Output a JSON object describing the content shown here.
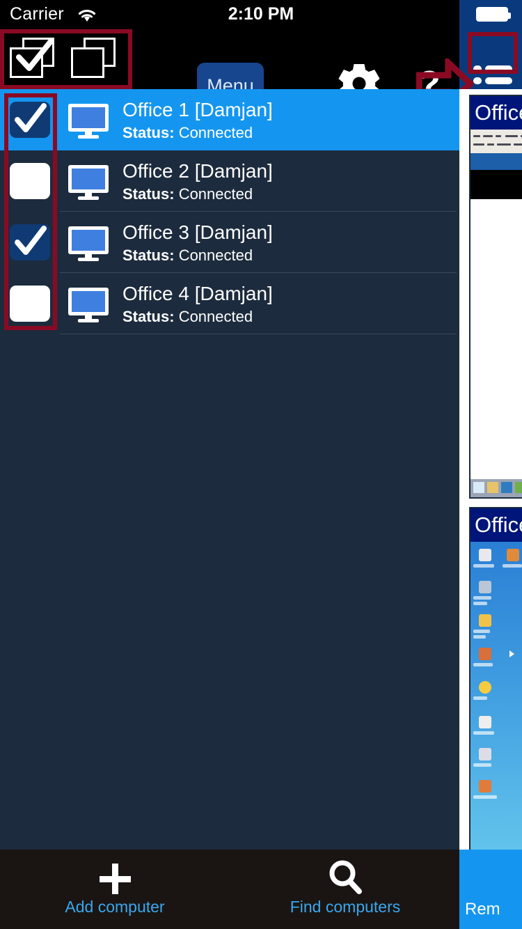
{
  "status_bar": {
    "carrier": "Carrier",
    "wifi_icon": "wifi-icon",
    "time": "2:10 PM",
    "battery_icon": "battery-full-icon"
  },
  "toolbar": {
    "select_all_icon": "select-all-checkbox-icon",
    "deselect_all_icon": "deselect-all-checkbox-icon",
    "menu_label": "Menu",
    "settings_icon": "gear-icon",
    "help_label": "?",
    "annotation_arrow_icon": "red-arrow-right-icon",
    "list_view_icon": "list-view-icon"
  },
  "computers": {
    "column_status_label": "Status:",
    "rows": [
      {
        "name": "Office 1 [Damjan]",
        "status_label": "Status:",
        "status": "Connected",
        "checked": true,
        "selected": true
      },
      {
        "name": "Office 2 [Damjan]",
        "status_label": "Status:",
        "status": "Connected",
        "checked": false,
        "selected": false
      },
      {
        "name": "Office 3 [Damjan]",
        "status_label": "Status:",
        "status": "Connected",
        "checked": true,
        "selected": false
      },
      {
        "name": "Office 4 [Damjan]",
        "status_label": "Status:",
        "status": "Connected",
        "checked": false,
        "selected": false
      }
    ]
  },
  "thumbnails": [
    {
      "title": "Office",
      "kind": "remote-desktop-preview-white"
    },
    {
      "title": "Office",
      "kind": "remote-desktop-preview-bluedesktop"
    }
  ],
  "bottom_bar": {
    "add_icon": "plus-icon",
    "add_label": "Add computer",
    "find_icon": "search-icon",
    "find_label": "Find computers",
    "right_panel_label": "Rem"
  },
  "colors": {
    "selected_row": "#1496f0",
    "background": "#1c2b3d",
    "accent_blue": "#3aa7ef",
    "menu_button": "#17468f",
    "annotation_red": "#8b0a23",
    "checkbox_checked": "#103a74",
    "bottom_bar": "#1a1512",
    "status_bar_right": "#0a3a7d"
  }
}
